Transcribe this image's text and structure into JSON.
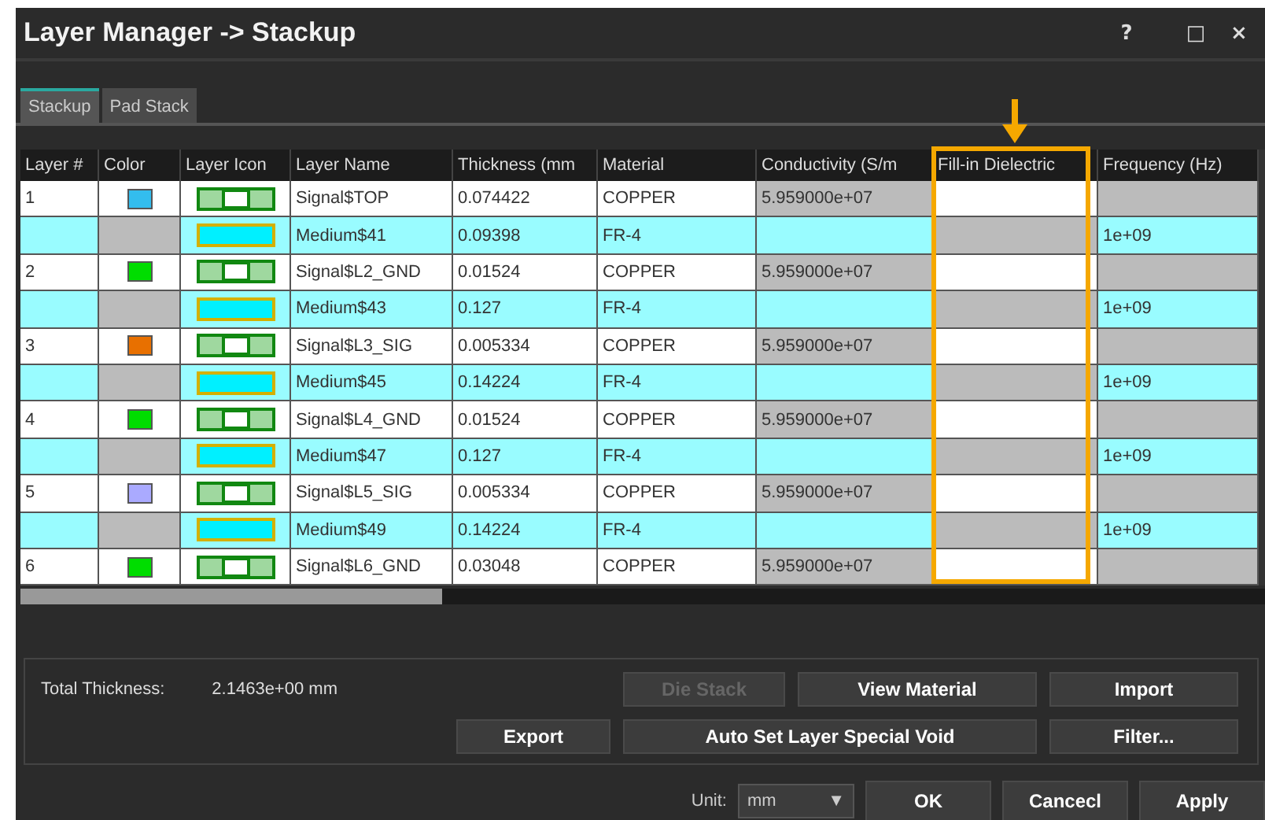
{
  "window": {
    "title": "Layer Manager -> Stackup",
    "controls": [
      "?",
      "□",
      "×"
    ]
  },
  "tabs": [
    {
      "label": "Stackup",
      "selected": true
    },
    {
      "label": "Pad Stack",
      "selected": false
    }
  ],
  "table": {
    "columns": [
      {
        "label": "Layer #",
        "highlighted": false
      },
      {
        "label": "Color",
        "highlighted": false
      },
      {
        "label": "Layer Icon",
        "highlighted": false
      },
      {
        "label": "Layer Name",
        "highlighted": false
      },
      {
        "label": "Thickness (mm",
        "highlighted": false
      },
      {
        "label": "Material",
        "highlighted": false
      },
      {
        "label": "Conductivity (S/m",
        "highlighted": false
      },
      {
        "label": "Fill-in Dielectric",
        "highlighted": true
      },
      {
        "label": "Frequency (Hz)",
        "highlighted": false
      }
    ],
    "rows": [
      {
        "kind": "signal",
        "layer": "1",
        "color": "#33bdee",
        "name": "Signal$TOP",
        "thickness": "0.074422",
        "material": "COPPER",
        "conductivity": "5.959000e+07"
      },
      {
        "kind": "medium",
        "name": "Medium$41",
        "thickness": "0.09398",
        "material": "FR-4",
        "frequency": "1e+09"
      },
      {
        "kind": "signal",
        "layer": "2",
        "color": "#00dd00",
        "name": "Signal$L2_GND",
        "thickness": "0.01524",
        "material": "COPPER",
        "conductivity": "5.959000e+07"
      },
      {
        "kind": "medium",
        "name": "Medium$43",
        "thickness": "0.127",
        "material": "FR-4",
        "frequency": "1e+09"
      },
      {
        "kind": "signal",
        "layer": "3",
        "color": "#e87000",
        "name": "Signal$L3_SIG",
        "thickness": "0.005334",
        "material": "COPPER",
        "conductivity": "5.959000e+07"
      },
      {
        "kind": "medium",
        "name": "Medium$45",
        "thickness": "0.14224",
        "material": "FR-4",
        "frequency": "1e+09"
      },
      {
        "kind": "signal",
        "layer": "4",
        "color": "#00dd00",
        "name": "Signal$L4_GND",
        "thickness": "0.01524",
        "material": "COPPER",
        "conductivity": "5.959000e+07"
      },
      {
        "kind": "medium",
        "name": "Medium$47",
        "thickness": "0.127",
        "material": "FR-4",
        "frequency": "1e+09"
      },
      {
        "kind": "signal",
        "layer": "5",
        "color": "#aaaaff",
        "name": "Signal$L5_SIG",
        "thickness": "0.005334",
        "material": "COPPER",
        "conductivity": "5.959000e+07"
      },
      {
        "kind": "medium",
        "name": "Medium$49",
        "thickness": "0.14224",
        "material": "FR-4",
        "frequency": "1e+09"
      },
      {
        "kind": "signal",
        "layer": "6",
        "color": "#00dd00",
        "name": "Signal$L6_GND",
        "thickness": "0.03048",
        "material": "COPPER",
        "conductivity": "5.959000e+07"
      }
    ]
  },
  "footer": {
    "total_label": "Total Thickness:",
    "total_value": "2.1463e+00 mm",
    "buttons": [
      {
        "label": "Die Stack",
        "disabled": true
      },
      {
        "label": "View Material",
        "disabled": false
      },
      {
        "label": "Import",
        "disabled": false
      },
      {
        "label": "Export",
        "disabled": false
      },
      {
        "label": "Auto Set Layer Special Void",
        "disabled": false
      },
      {
        "label": "Filter...",
        "disabled": false
      }
    ]
  },
  "unit": {
    "label": "Unit:",
    "value": "mm",
    "arrow": "▼"
  },
  "dialog_buttons": [
    "OK",
    "Cancecl",
    "Apply"
  ]
}
